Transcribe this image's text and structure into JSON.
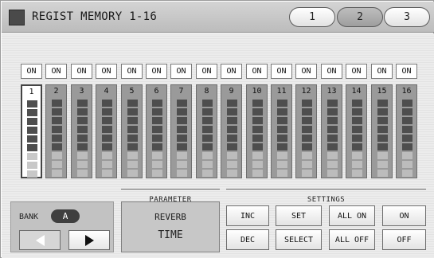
{
  "header": {
    "title": "REGIST MEMORY 1-16",
    "tabs": [
      {
        "label": "1",
        "active": false
      },
      {
        "label": "2",
        "active": true
      },
      {
        "label": "3",
        "active": false
      }
    ]
  },
  "on_buttons": [
    "ON",
    "ON",
    "ON",
    "ON",
    "ON",
    "ON",
    "ON",
    "ON",
    "ON",
    "ON",
    "ON",
    "ON",
    "ON",
    "ON",
    "ON",
    "ON"
  ],
  "banks": [
    {
      "label": "1",
      "selected": true
    },
    {
      "label": "2"
    },
    {
      "label": "3"
    },
    {
      "label": "4"
    },
    {
      "label": "5"
    },
    {
      "label": "6"
    },
    {
      "label": "7"
    },
    {
      "label": "8"
    },
    {
      "label": "9"
    },
    {
      "label": "10"
    },
    {
      "label": "11"
    },
    {
      "label": "12"
    },
    {
      "label": "13"
    },
    {
      "label": "14"
    },
    {
      "label": "15"
    },
    {
      "label": "16"
    }
  ],
  "parameter": {
    "header": "PARAMETER",
    "line1": "REVERB",
    "line2": "TIME"
  },
  "bank_selector": {
    "label": "BANK",
    "value": "A"
  },
  "settings": {
    "header": "SETTINGS",
    "inc": "INC",
    "dec": "DEC",
    "set": "SET",
    "select": "SELECT",
    "all_on": "ALL ON",
    "all_off": "ALL OFF",
    "on": "ON",
    "off": "OFF"
  },
  "colors": {
    "header_bg": "#c8c8c8",
    "selected_bank": "#ffffff",
    "bank_bg": "#9a9a9a",
    "bar_dark": "#4e4e4e",
    "bar_light": "#bcbcbc"
  }
}
